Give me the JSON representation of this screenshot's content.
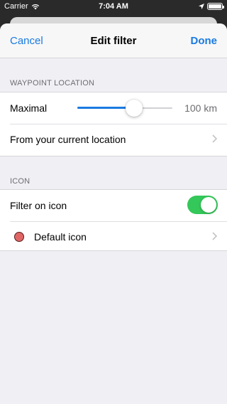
{
  "status_bar": {
    "carrier": "Carrier",
    "time": "7:04 AM"
  },
  "nav": {
    "cancel": "Cancel",
    "title": "Edit filter",
    "done": "Done"
  },
  "sections": {
    "waypoint_location": "WAYPOINT LOCATION",
    "icon": "ICON"
  },
  "distance": {
    "label": "Maximal",
    "value": "100 km",
    "slider_fraction": 0.6
  },
  "from_location": {
    "label": "From your current location"
  },
  "filter_on_icon": {
    "label": "Filter on icon",
    "enabled": true
  },
  "default_icon": {
    "label": "Default icon",
    "color": "#e06666"
  },
  "colors": {
    "accent": "#1a7ae0",
    "toggle_on": "#34c759"
  }
}
